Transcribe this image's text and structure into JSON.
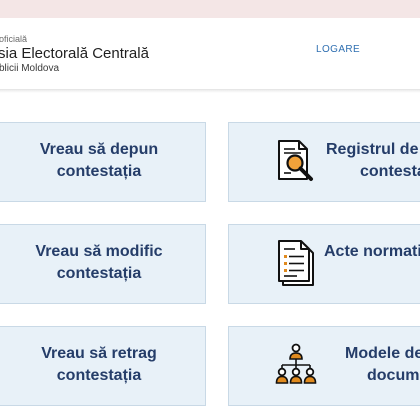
{
  "header": {
    "org_small": "oficială",
    "org_name": "sia Electorală Centrală",
    "org_sub": "blicii Moldova",
    "login_label": "LOGARE"
  },
  "cards": [
    {
      "line1": "Vreau să depun",
      "line2": "contestația"
    },
    {
      "line1": "Registrul de e",
      "line2": "contesta",
      "icon": "document-search-icon"
    },
    {
      "line1": "Vreau să modific",
      "line2": "contestația"
    },
    {
      "line1": "Acte normativ",
      "line2": "",
      "icon": "document-list-icon"
    },
    {
      "line1": "Vreau să retrag",
      "line2": "contestația"
    },
    {
      "line1": "Modele de",
      "line2": "docume",
      "icon": "hierarchy-people-icon"
    }
  ],
  "colors": {
    "card_bg": "#e8f1f8",
    "card_text": "#253d69",
    "link": "#2f6fb1",
    "top_strip": "#f4e6e6"
  }
}
